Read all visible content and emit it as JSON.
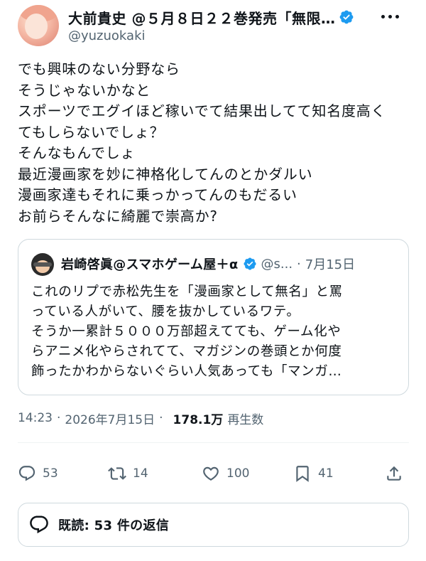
{
  "author": {
    "display_name": "大前貴史 @５月８日２２巻発売「無限…",
    "handle": "@yuzuokaki",
    "avatar_icon": "user-avatar",
    "verified_color": "#1d9bf0"
  },
  "tweet": {
    "lines": [
      "でも興味のない分野なら",
      "そうじゃないかなと",
      "スポーツでエグイほど稼いでて結果出してて知名度高く",
      "てもしらないでしょ？",
      "そんなもんでしょ",
      "最近漫画家を妙に神格化してんのとかダルい",
      "漫画家達もそれに乗っかってんのもだるい",
      "お前らそんなに綺麗で崇高か?"
    ]
  },
  "quote": {
    "name": "岩崎啓眞@スマホゲーム屋＋α",
    "handle": "@s...",
    "separator": "·",
    "date": "7月15日",
    "lines": [
      "これのリプで赤松先生を「漫画家として無名」と罵",
      "っている人がいて、腰を抜かしているワテ。",
      "そうか一累計５０００万部超えてても、ゲーム化や",
      "らアニメ化やらされてて、マガジンの巻頭とか何度",
      "飾ったかわからないぐらい人気あっても「マンガ…"
    ]
  },
  "meta": {
    "time": "14:23",
    "dot1": "·",
    "date": "2026年7月15日",
    "dot2": "·",
    "views": "178.1万",
    "views_label": "再生数"
  },
  "actions": {
    "reply_count": "53",
    "retweet_count": "14",
    "like_count": "100",
    "bookmark_count": "41"
  },
  "replies_bar": {
    "label": "既読: 53 件の返信"
  },
  "colors": {
    "text": "#0f1419",
    "secondary": "#536471",
    "border": "#cfd9de",
    "accent": "#1d9bf0"
  }
}
